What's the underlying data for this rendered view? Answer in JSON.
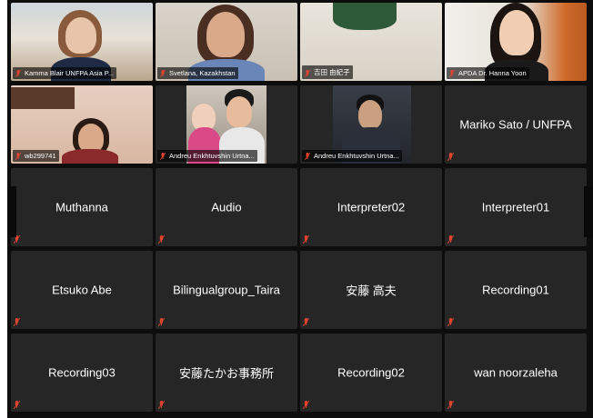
{
  "tiles": [
    {
      "name": "Kamma Blair UNFPA Asia P...",
      "video": true
    },
    {
      "name": "Svetlana, Kazakhstan",
      "video": true
    },
    {
      "name": "吉田 由紀子",
      "video": true
    },
    {
      "name": "APDA Dr. Hanna Yoon",
      "video": true
    },
    {
      "name": "wb299741",
      "video": true
    },
    {
      "name": "Andreu Enkhtuvshin Urtna...",
      "video": true
    },
    {
      "name": "Andreu Enkhtuvshin Urtna...",
      "video": true
    },
    {
      "name": "Mariko Sato / UNFPA",
      "video": false
    },
    {
      "name": "Muthanna",
      "video": false
    },
    {
      "name": "Audio",
      "video": false
    },
    {
      "name": "Interpreter02",
      "video": false
    },
    {
      "name": "Interpreter01",
      "video": false
    },
    {
      "name": "Etsuko Abe",
      "video": false
    },
    {
      "name": "Bilingualgroup_Taira",
      "video": false
    },
    {
      "name": "安藤 高夫",
      "video": false
    },
    {
      "name": "Recording01",
      "video": false
    },
    {
      "name": "Recording03",
      "video": false
    },
    {
      "name": "安藤たかお事務所",
      "video": false
    },
    {
      "name": "Recording02",
      "video": false
    },
    {
      "name": "wan noorzaleha",
      "video": false
    }
  ],
  "colors": {
    "muted_icon": "#e0442e",
    "tile_bg": "#262626",
    "gallery_bg": "#0d0d0d"
  },
  "icons": {
    "muted": "microphone-muted-icon"
  }
}
